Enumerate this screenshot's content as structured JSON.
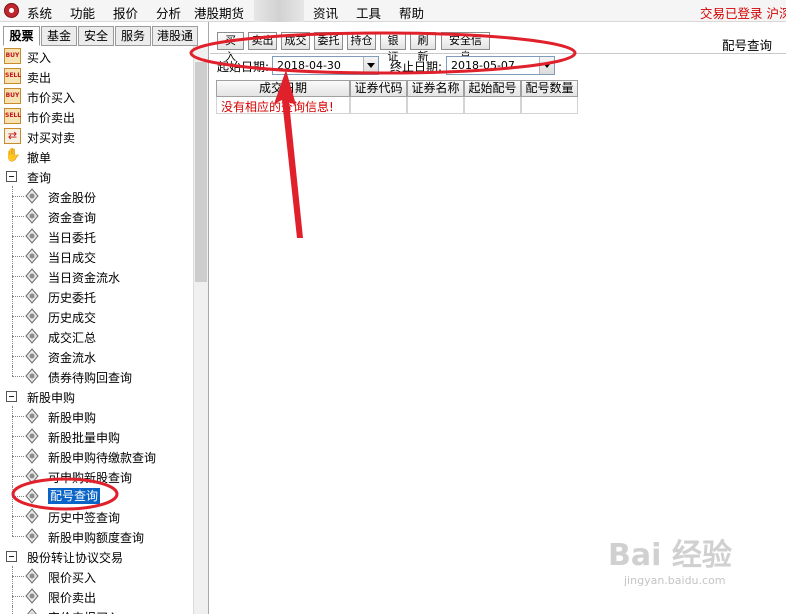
{
  "menubar": {
    "items": [
      "系统",
      "功能",
      "报价",
      "分析",
      "港股期货",
      "资讯",
      "工具",
      "帮助"
    ],
    "status": "交易已登录 沪深"
  },
  "market_tabs": [
    "股票",
    "基金",
    "安全",
    "服务",
    "港股通"
  ],
  "tree": {
    "trade_items": [
      {
        "label": "买入",
        "icon": "BUY"
      },
      {
        "label": "卖出",
        "icon": "SELL"
      },
      {
        "label": "市价买入",
        "icon": "BUY"
      },
      {
        "label": "市价卖出",
        "icon": "SELL"
      },
      {
        "label": "对买对卖",
        "icon": "swap"
      },
      {
        "label": "撤单",
        "icon": "hand"
      }
    ],
    "query": {
      "label": "查询",
      "children": [
        "资金股份",
        "资金查询",
        "当日委托",
        "当日成交",
        "当日资金流水",
        "历史委托",
        "历史成交",
        "成交汇总",
        "资金流水",
        "债券待购回查询"
      ]
    },
    "ipo": {
      "label": "新股申购",
      "children": [
        "新股申购",
        "新股批量申购",
        "新股申购待缴款查询",
        "可申购新股查询",
        "配号查询",
        "历史中签查询",
        "新股申购额度查询"
      ],
      "selected_index": 4
    },
    "transfer": {
      "label": "股份转让协议交易",
      "children": [
        "限价买入",
        "限价卖出",
        "定价申报买入"
      ]
    }
  },
  "toolbar": {
    "buttons": [
      "买入",
      "卖出",
      "成交",
      "委托",
      "持仓",
      "银证",
      "刷新",
      "安全信息"
    ],
    "title": "配号查询"
  },
  "filters": {
    "start_label": "起始日期:",
    "start_date": "2018-04-30",
    "end_label": "终止日期:",
    "end_date": "2018-05-07"
  },
  "table": {
    "columns": [
      "成交日期",
      "证券代码",
      "证券名称",
      "起始配号",
      "配号数量"
    ],
    "empty_message": "没有相应的查询信息!"
  },
  "watermark": {
    "main": "Bai 经验",
    "sub": "jingyan.baidu.com"
  },
  "colors": {
    "annotation": "#e0202a",
    "selected": "#0a64c8",
    "status_text": "#d40000"
  }
}
